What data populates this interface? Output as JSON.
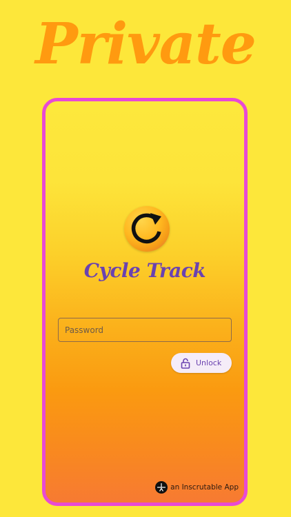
{
  "headline": "Private",
  "app": {
    "name": "Cycle Track",
    "logo_icon": "refresh-cycle-icon"
  },
  "login": {
    "password_placeholder": "Password",
    "password_value": "",
    "unlock_label": "Unlock",
    "unlock_icon": "padlock-icon"
  },
  "footer": {
    "credit": "an Inscrutable App",
    "maker_icon": "inscrutable-logo-icon"
  },
  "colors": {
    "background": "#fde73a",
    "headline": "#ff9a10",
    "frame_border": "#e84ad4",
    "brand_text": "#6a42b0",
    "button_bg": "#f5ecf8"
  }
}
